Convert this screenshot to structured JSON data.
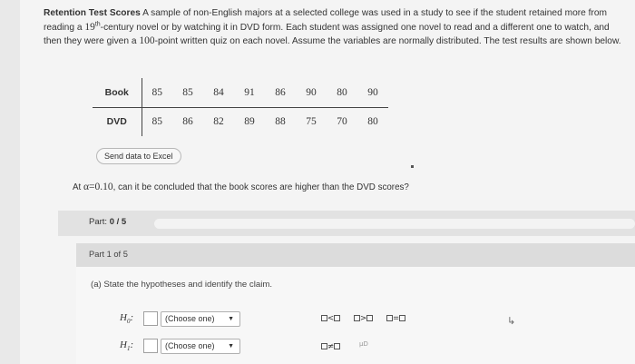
{
  "problem": {
    "title": "Retention Test Scores",
    "text_a": "A sample of non-English majors at a selected college was used in a study to see if the student retained more from reading a",
    "century_num": "19",
    "century_sup": "th",
    "text_b": "-century novel or by watching it in DVD form. Each student was assigned one novel to read and a different one to watch, and then they were given a",
    "points": "100",
    "text_c": "-point written quiz on each novel. Assume the variables are normally distributed. The test results are shown below."
  },
  "table": {
    "rows": [
      {
        "label": "Book",
        "values": [
          "85",
          "85",
          "84",
          "91",
          "86",
          "90",
          "80",
          "90"
        ]
      },
      {
        "label": "DVD",
        "values": [
          "85",
          "86",
          "82",
          "89",
          "88",
          "75",
          "70",
          "80"
        ]
      }
    ]
  },
  "excel_button": "Send data to Excel",
  "question": {
    "prefix": "At",
    "alpha": "α",
    "eq": "=",
    "alpha_value": "0.10",
    "suffix": ", can it be concluded that the book scores are higher than the DVD scores?"
  },
  "progress": {
    "label": "Part:",
    "value": "0 / 5",
    "fraction": 0
  },
  "part": {
    "header": "Part 1 of 5",
    "instruction": "(a) State the hypotheses and identify the claim.",
    "h0_main": "H",
    "h0_sub": "0",
    "h1_main": "H",
    "h1_sub": "1",
    "colon": ":",
    "select_placeholder": "(Choose one)",
    "caret": "▼"
  },
  "symbols": {
    "lt": "<",
    "gt": ">",
    "eq": "=",
    "ne": "≠",
    "mu_d": "μD"
  },
  "icons": {
    "cursor": "pointer-cursor-icon"
  }
}
